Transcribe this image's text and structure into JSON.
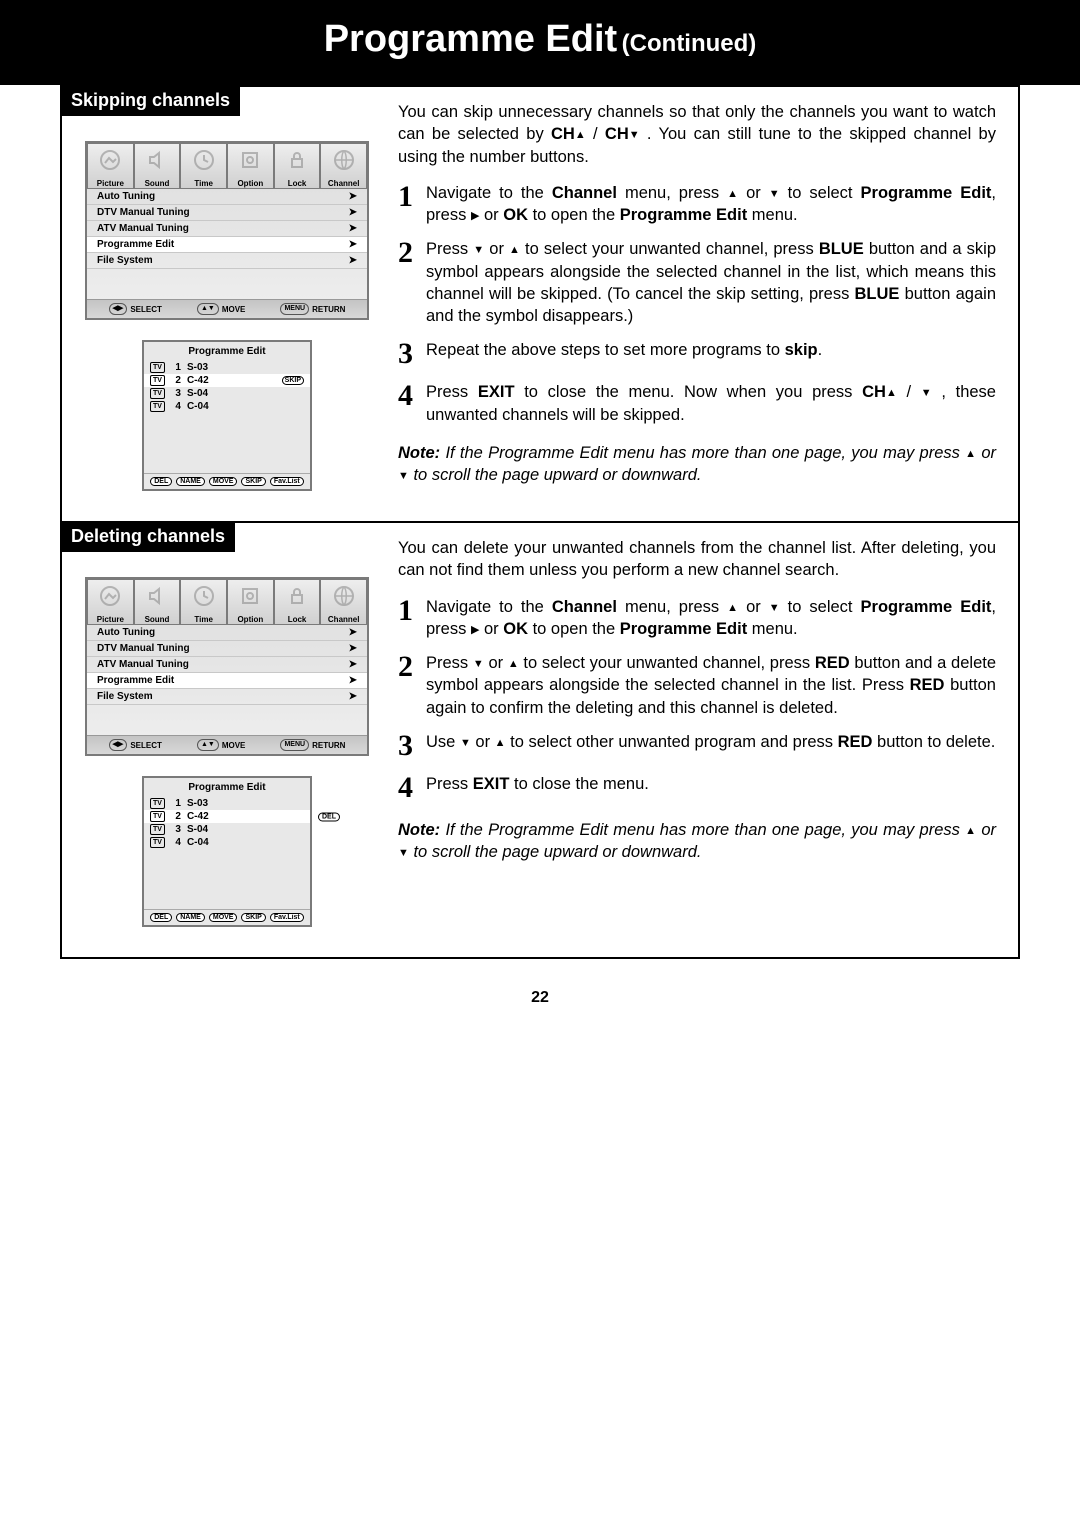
{
  "header": {
    "title_main": "Programme Edit",
    "title_sub": "(Continued)"
  },
  "page_number": "22",
  "osd": {
    "tabs": [
      "Picture",
      "Sound",
      "Time",
      "Option",
      "Lock",
      "Channel"
    ],
    "items": [
      {
        "label": "Auto Tuning"
      },
      {
        "label": "DTV Manual Tuning"
      },
      {
        "label": "ATV Manual Tuning"
      },
      {
        "label": "Programme Edit",
        "selected": true
      },
      {
        "label": "File System"
      }
    ],
    "footer": {
      "select": "SELECT",
      "move": "MOVE",
      "ret": "RETURN",
      "menu": "MENU"
    }
  },
  "chlist": {
    "title": "Programme Edit",
    "rows": [
      {
        "tag": "TV",
        "idx": "1",
        "name": "S-03"
      },
      {
        "tag": "TV",
        "idx": "2",
        "name": "C-42",
        "selected": true
      },
      {
        "tag": "TV",
        "idx": "3",
        "name": "S-04"
      },
      {
        "tag": "TV",
        "idx": "4",
        "name": "C-04"
      }
    ],
    "footer": [
      "DEL",
      "NAME",
      "MOVE",
      "SKIP",
      "Fav.List"
    ]
  },
  "skip_badge": "SKIP",
  "del_badge": "DEL",
  "sections": {
    "skipping": {
      "label": "Skipping channels",
      "intro_parts": {
        "p1": "You can skip unnecessary channels so that only the channels you want to watch can be selected by ",
        "b1": "CH",
        "sep1": " / ",
        "b2": "CH",
        "p2": " . You can still tune to the skipped channel by using the number buttons."
      },
      "steps": {
        "s1": {
          "num": "1",
          "a": "Navigate to the ",
          "b1": "Channel",
          "b": " menu,   press ",
          "c": " or ",
          "d": " to select ",
          "b2": "Programme Edit",
          "e": ", press  ",
          "f": "  or ",
          "b3": "OK",
          "g": " to open the ",
          "b4": "Programme Edit",
          "h": " menu."
        },
        "s2": {
          "num": "2",
          "a": "Press ",
          "b": " or ",
          "c": " to select your unwanted channel, press ",
          "b1": "BLUE",
          "d": " button and a skip symbol appears alongside the selected channel in the list, which means this channel will be skipped. (To cancel the skip setting, press ",
          "b2": "BLUE",
          "e": " button again and the symbol disappears.)"
        },
        "s3": {
          "num": "3",
          "a": "Repeat the above steps to set more programs to ",
          "b1": "skip",
          "b": "."
        },
        "s4": {
          "num": "4",
          "a": "Press ",
          "b1": "EXIT",
          "b": " to close the menu. Now when you press ",
          "b2": "CH",
          "c": " / ",
          "d": " , these unwanted channels will be skipped."
        }
      },
      "note": {
        "b1": "Note:",
        "a": " If the Programme Edit menu has more than one page, you may press ",
        "b": " or ",
        "c": "  to scroll the page upward or downward."
      }
    },
    "deleting": {
      "label": "Deleting channels",
      "intro": "You can delete your unwanted channels from the channel list. After deleting, you can not find them unless you perform a new channel search.",
      "steps": {
        "s1": {
          "num": "1"
        },
        "s2": {
          "num": "2",
          "a": "Press ",
          "b": " or ",
          "c": " to select your unwanted channel, press ",
          "b1": "RED",
          "d": " button and a delete symbol appears alongside the selected channel in the list. Press ",
          "b2": "RED",
          "e": " button again to confirm the deleting and this channel is deleted."
        },
        "s3": {
          "num": "3",
          "a": "Use ",
          "b": " or ",
          "c": " to select other unwanted program and press ",
          "b1": "RED",
          "d": " button to delete."
        },
        "s4": {
          "num": "4",
          "a": "Press ",
          "b1": "EXIT",
          "b": " to close the menu."
        }
      },
      "note": {
        "b1": "Note:",
        "a": " If the Programme Edit menu has more than one page, you may press ",
        "b": " or ",
        "c": "  to scroll the page upward or downward."
      }
    }
  }
}
